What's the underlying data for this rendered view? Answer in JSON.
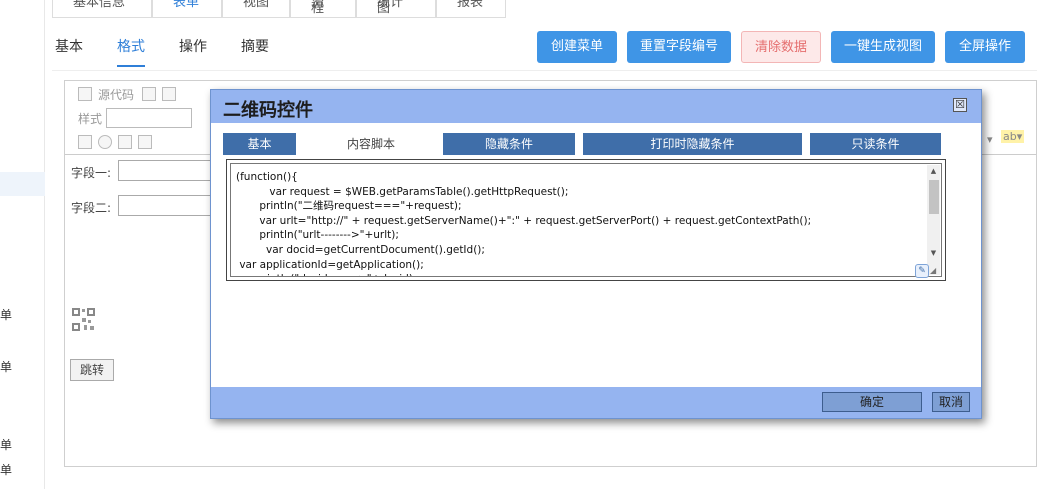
{
  "top_tabs": [
    "基本信息",
    "表单",
    "视图",
    "流程",
    "统计图",
    "报表"
  ],
  "top_tab_active": 1,
  "sub_tabs": [
    "基本",
    "格式",
    "操作",
    "摘要"
  ],
  "sub_tab_active": 1,
  "buttons": {
    "create_menu": "创建菜单",
    "reset_field_numbers": "重置字段编号",
    "clear_data": "清除数据",
    "generate_view": "一键生成视图",
    "fullscreen": "全屏操作"
  },
  "sidebar_labels": [
    "单",
    "单",
    "单",
    "单"
  ],
  "toolbar": {
    "source_code": "源代码",
    "style": "样式"
  },
  "form": {
    "field1_label": "字段一:",
    "field2_label": "字段二:",
    "jump_button": "跳转"
  },
  "dialog": {
    "title": "二维码控件",
    "close": "☒",
    "tabs": [
      "基本",
      "内容脚本",
      "隐藏条件",
      "打印时隐藏条件",
      "只读条件"
    ],
    "active_tab": 1,
    "code": "(function(){\n          var request = $WEB.getParamsTable().getHttpRequest();\n       println(\"二维码request===\"+request);\n       var urlt=\"http://\" + request.getServerName()+\":\" + request.getServerPort() + request.getContextPath();\n       println(\"urlt-------->\"+urlt);\n         var docid=getCurrentDocument().getId();\n var applicationId=getApplication();\n      println(\"docid-------->\"+docid);",
    "ok": "确定",
    "cancel": "取消"
  },
  "colors": {
    "primary_button": "#3f95e6",
    "dialog_header": "#95b4f0",
    "dialog_tab": "#3f6ea9",
    "danger_bg": "#fde9e9"
  }
}
